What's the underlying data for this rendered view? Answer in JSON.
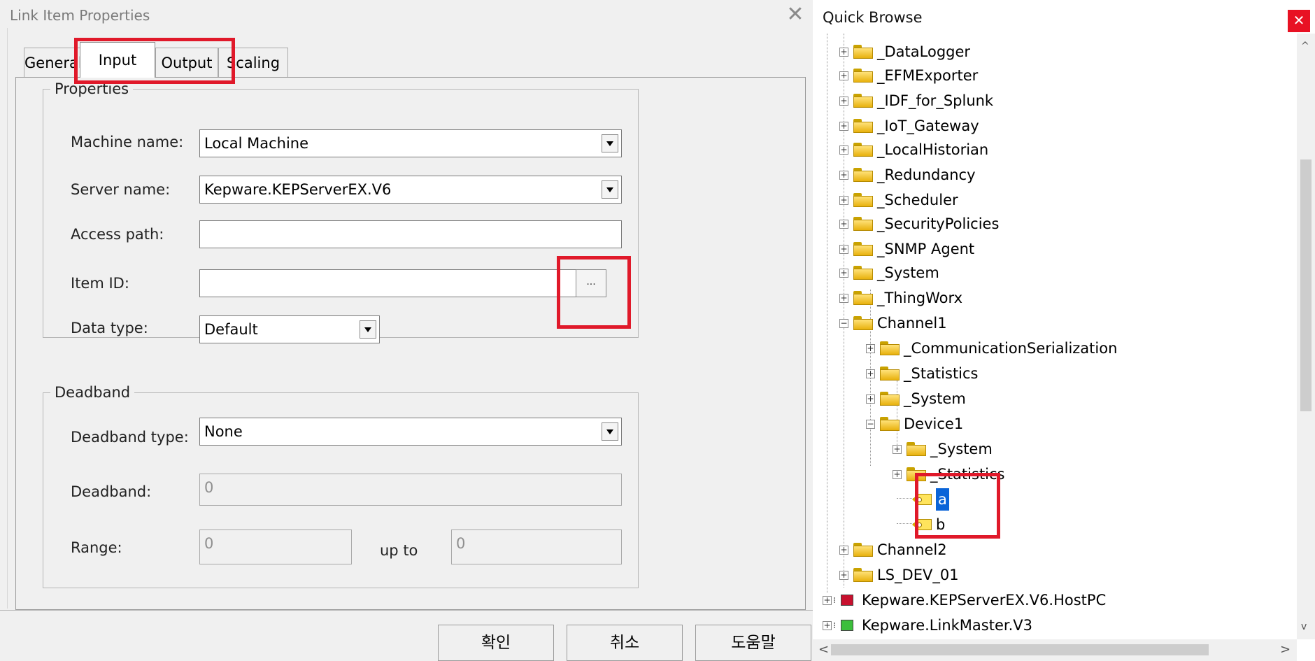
{
  "dialog": {
    "title": "Link Item Properties",
    "tabs": [
      {
        "label": "General"
      },
      {
        "label": "Input"
      },
      {
        "label": "Output"
      },
      {
        "label": "Scaling"
      }
    ],
    "active_tab": "Input",
    "properties": {
      "legend": "Properties",
      "machine_name_label": "Machine name:",
      "machine_name_value": "Local Machine",
      "server_name_label": "Server name:",
      "server_name_value": "Kepware.KEPServerEX.V6",
      "access_path_label": "Access path:",
      "access_path_value": "",
      "item_id_label": "Item ID:",
      "item_id_value": "",
      "browse_button_label": "...",
      "data_type_label": "Data type:",
      "data_type_value": "Default"
    },
    "deadband": {
      "legend": "Deadband",
      "type_label": "Deadband type:",
      "type_value": "None",
      "deadband_label": "Deadband:",
      "deadband_value": "0",
      "range_label": "Range:",
      "range_from": "0",
      "up_to_label": "up to",
      "range_to": "0"
    },
    "buttons": {
      "ok": "확인",
      "cancel": "취소",
      "help": "도움말"
    }
  },
  "browse": {
    "title": "Quick Browse",
    "tree": [
      {
        "label": "_DataLogger"
      },
      {
        "label": "_EFMExporter"
      },
      {
        "label": "_IDF_for_Splunk"
      },
      {
        "label": "_IoT_Gateway"
      },
      {
        "label": "_LocalHistorian"
      },
      {
        "label": "_Redundancy"
      },
      {
        "label": "_Scheduler"
      },
      {
        "label": "_SecurityPolicies"
      },
      {
        "label": "_SNMP Agent"
      },
      {
        "label": "_System"
      },
      {
        "label": "_ThingWorx"
      },
      {
        "label": "Channel1"
      },
      {
        "label": "_CommunicationSerialization"
      },
      {
        "label": "_Statistics"
      },
      {
        "label": "_System"
      },
      {
        "label": "Device1"
      },
      {
        "label": "_System"
      },
      {
        "label": "_Statistics"
      },
      {
        "label": "a"
      },
      {
        "label": "b"
      },
      {
        "label": "Channel2"
      },
      {
        "label": "LS_DEV_01"
      },
      {
        "label": "Kepware.KEPServerEX.V6.HostPC"
      },
      {
        "label": "Kepware.LinkMaster.V3"
      }
    ],
    "selected_item": "a"
  },
  "colors": {
    "highlight": "#e0192a",
    "selection": "#0a64d8",
    "close_button": "#e81123"
  }
}
